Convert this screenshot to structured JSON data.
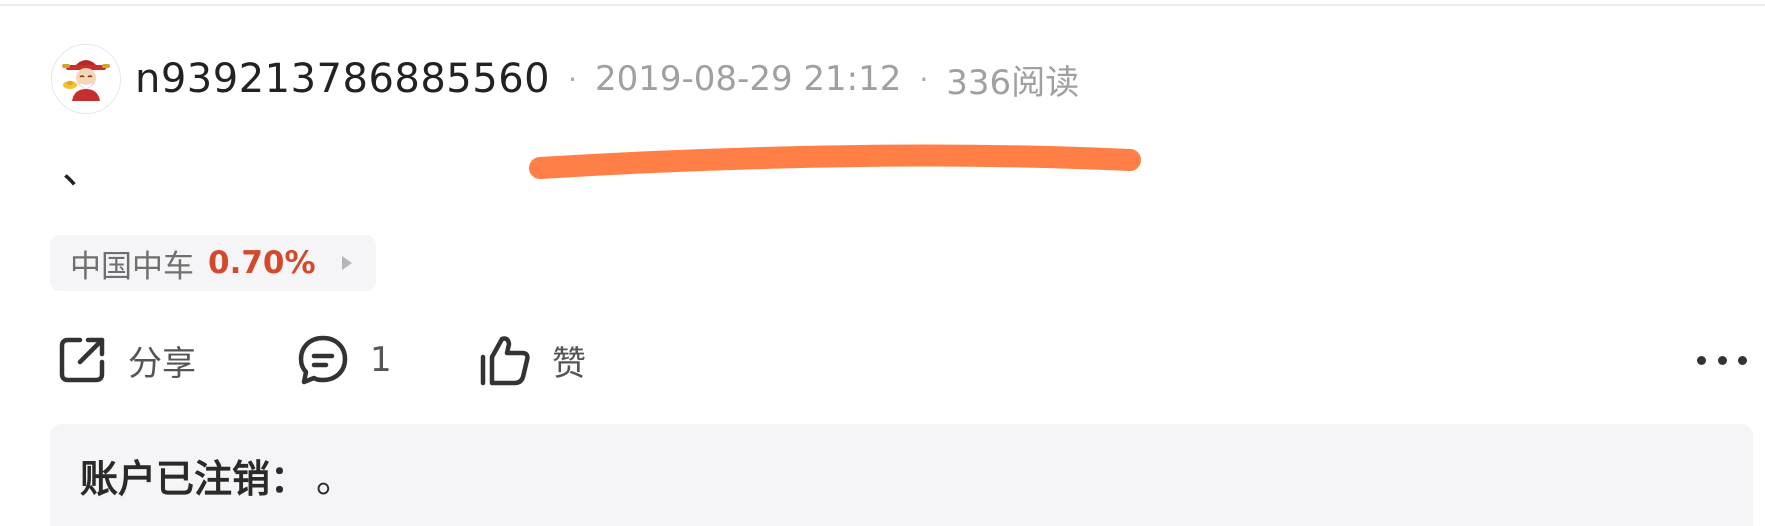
{
  "post": {
    "username": "n939213786885560",
    "separator": "·",
    "timestamp": "2019-08-29 21:12",
    "reads": "336阅读",
    "body": "、"
  },
  "stock_tag": {
    "name": "中国中车",
    "change": "0.70%",
    "change_color": "#d4482c"
  },
  "actions": {
    "share_label": "分享",
    "comment_count": "1",
    "like_label": "赞"
  },
  "comment": {
    "author": "账户已注销：",
    "text": "。"
  },
  "colors": {
    "redaction_stroke": "#ff7f47"
  },
  "icons": {
    "avatar": "caishen-avatar",
    "share": "share-icon",
    "comment": "comment-icon",
    "like": "thumbs-up-icon",
    "more": "more-icon"
  }
}
